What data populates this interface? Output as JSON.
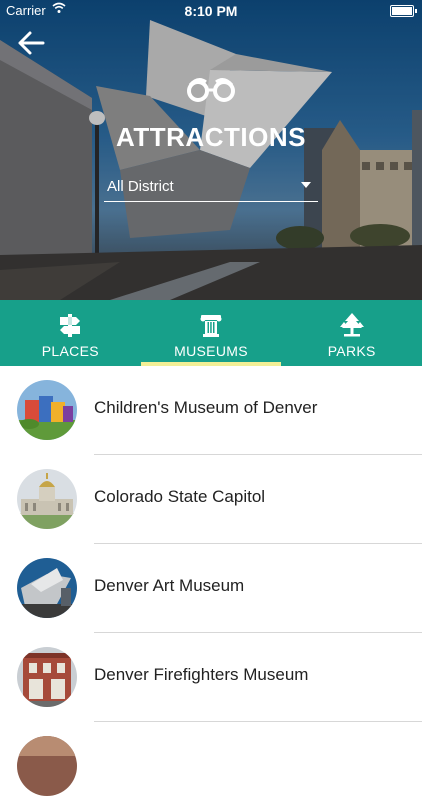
{
  "status_bar": {
    "carrier": "Carrier",
    "time": "8:10 PM"
  },
  "header": {
    "title": "ATTRACTIONS",
    "district": "All District"
  },
  "tabs": [
    {
      "label": "PLACES",
      "icon": "signpost-icon",
      "selected": false
    },
    {
      "label": "MUSEUMS",
      "icon": "column-icon",
      "selected": true
    },
    {
      "label": "PARKS",
      "icon": "tree-icon",
      "selected": false
    }
  ],
  "colors": {
    "teal": "#17a08a",
    "tab_underline": "#f2ef96"
  },
  "list": [
    {
      "name": "Children's Museum of Denver"
    },
    {
      "name": "Colorado State Capitol"
    },
    {
      "name": "Denver Art Museum"
    },
    {
      "name": "Denver Firefighters Museum"
    }
  ]
}
